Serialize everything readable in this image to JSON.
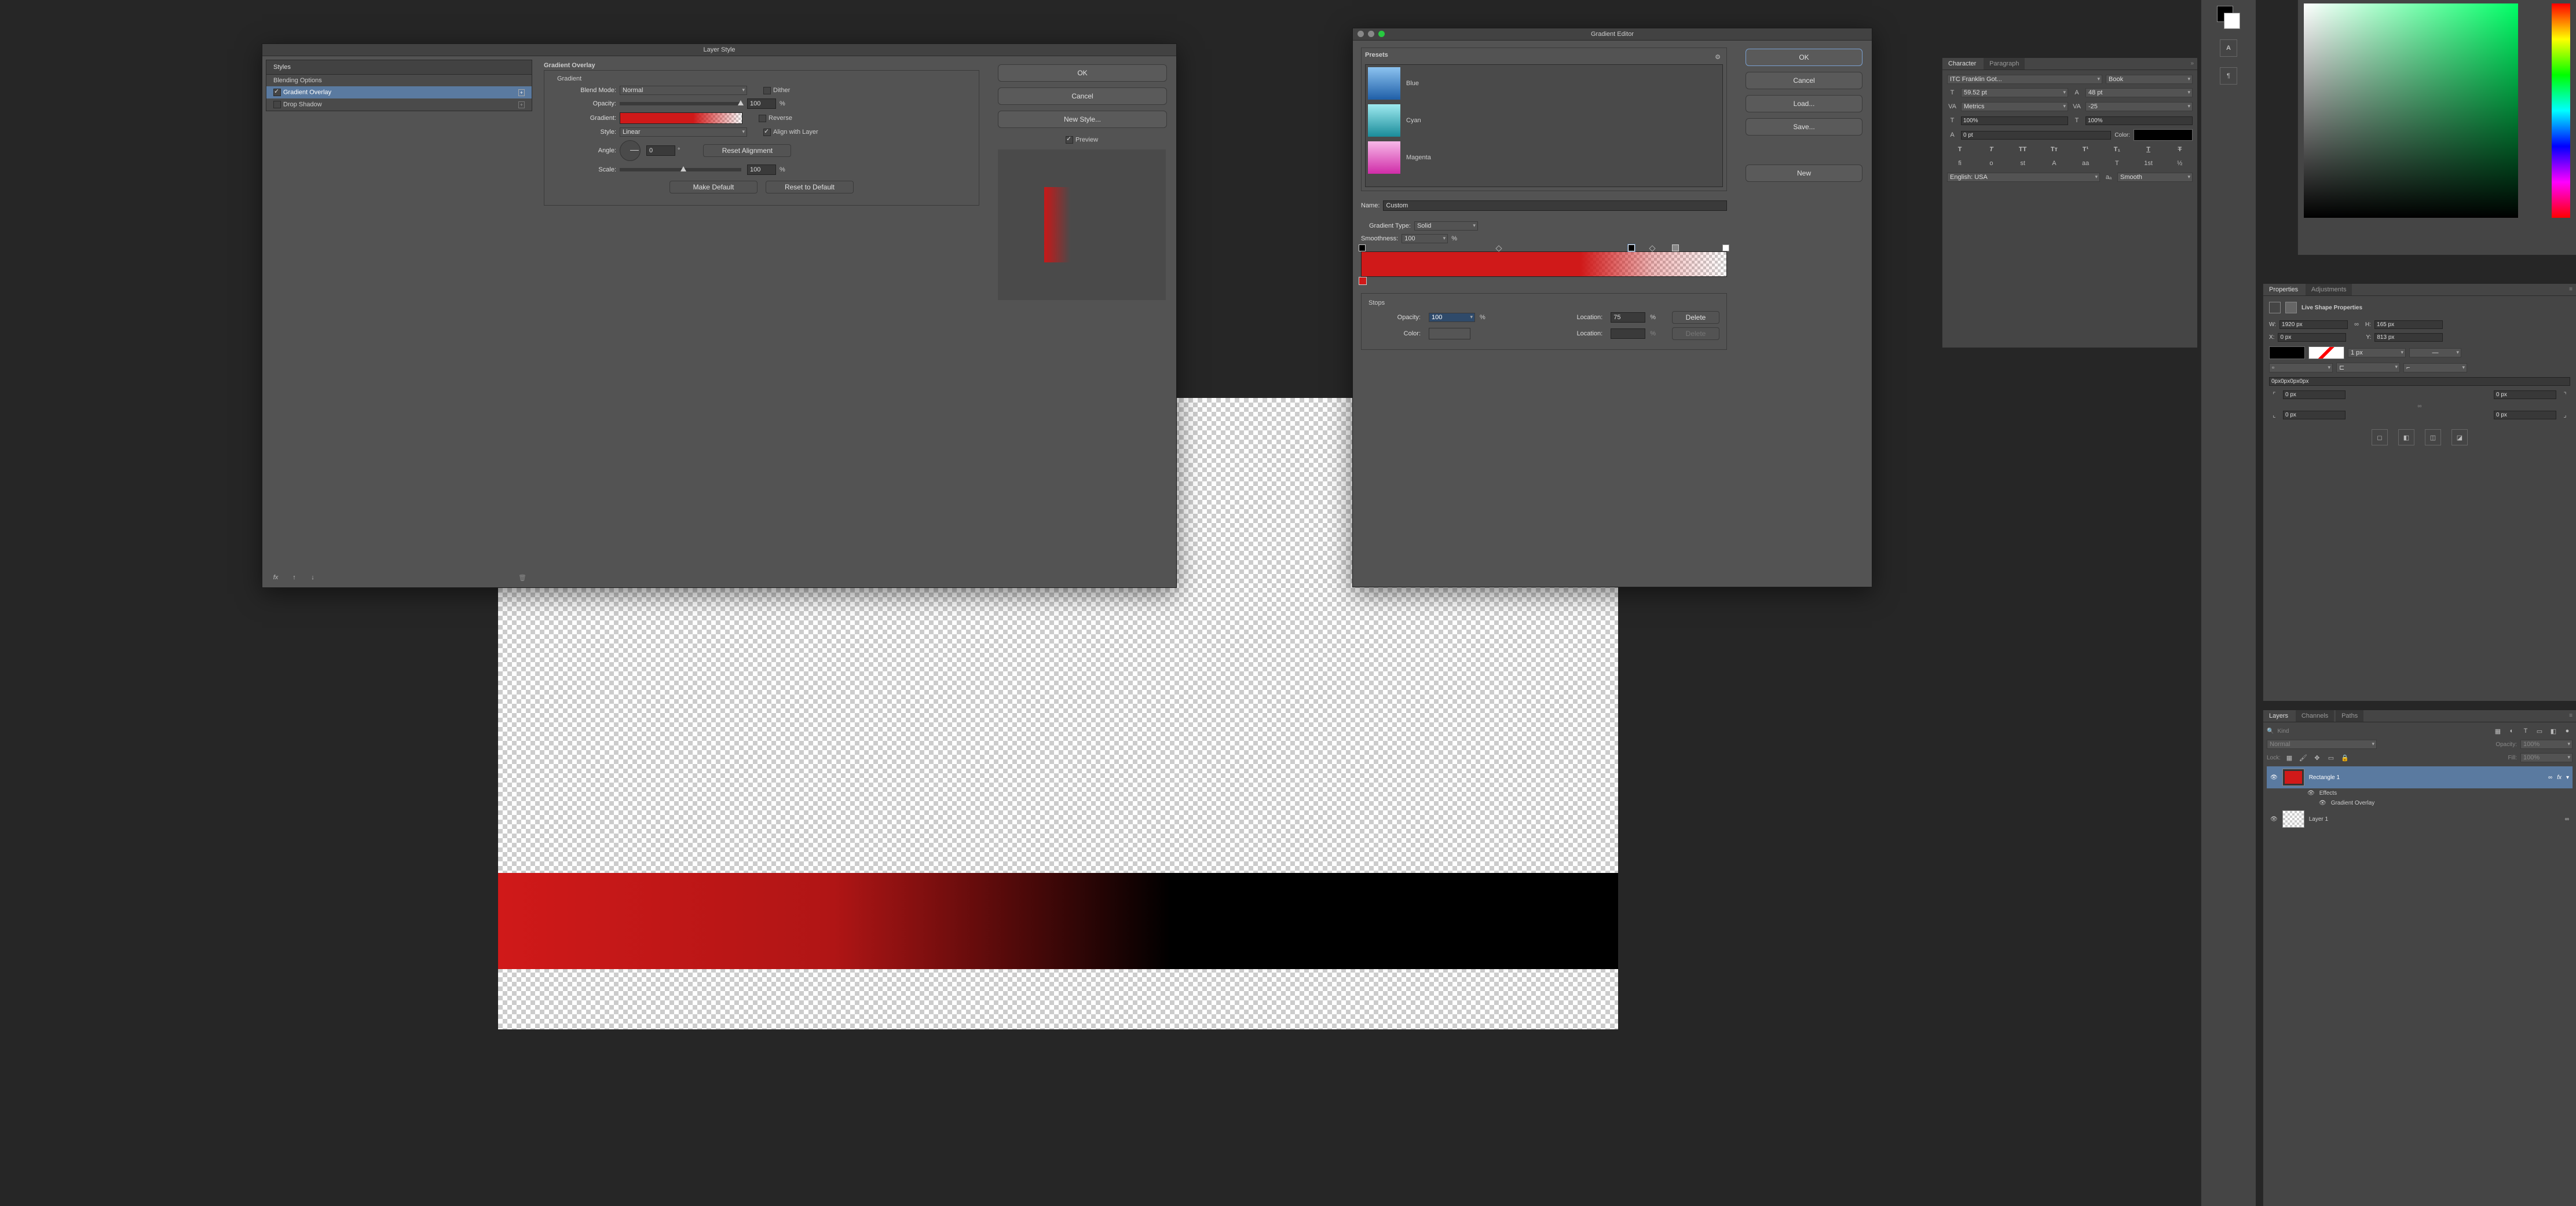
{
  "layer_style": {
    "title": "Layer Style",
    "styles_header": "Styles",
    "styles": [
      "Blending Options",
      "Gradient Overlay",
      "Drop Shadow"
    ],
    "active_style": "Gradient Overlay",
    "section_title": "Gradient Overlay",
    "subsection": "Gradient",
    "blend_mode_label": "Blend Mode:",
    "blend_mode_value": "Normal",
    "dither_label": "Dither",
    "opacity_label": "Opacity:",
    "opacity_value": "100",
    "pct": "%",
    "gradient_label": "Gradient:",
    "reverse_label": "Reverse",
    "style_label": "Style:",
    "style_value": "Linear",
    "align_label": "Align with Layer",
    "angle_label": "Angle:",
    "angle_value": "0",
    "degree": "°",
    "reset_alignment": "Reset Alignment",
    "scale_label": "Scale:",
    "scale_value": "100",
    "make_default": "Make Default",
    "reset_default": "Reset to Default",
    "ok": "OK",
    "cancel": "Cancel",
    "new_style": "New Style...",
    "preview": "Preview"
  },
  "gradient_editor": {
    "title": "Gradient Editor",
    "presets_label": "Presets",
    "presets": [
      "Blue",
      "Cyan",
      "Magenta"
    ],
    "preset_colors": [
      "#4a90e2",
      "#3bd4d4",
      "#e055c3"
    ],
    "name_label": "Name:",
    "name_value": "Custom",
    "type_label": "Gradient Type:",
    "type_value": "Solid",
    "smoothness_label": "Smoothness:",
    "smoothness_value": "100",
    "pct": "%",
    "stops_label": "Stops",
    "opacity_label": "Opacity:",
    "opacity_value": "100",
    "location_label": "Location:",
    "location_value": "75",
    "color_label": "Color:",
    "delete": "Delete",
    "ok": "OK",
    "cancel": "Cancel",
    "load": "Load...",
    "save": "Save...",
    "new": "New"
  },
  "character": {
    "tab1": "Character",
    "tab2": "Paragraph",
    "font": "ITC Franklin Got...",
    "weight": "Book",
    "size": "59.52 pt",
    "leading": "48 pt",
    "kerning": "Metrics",
    "tracking": "-25",
    "vscale": "100%",
    "hscale": "100%",
    "baseline": "0 pt",
    "color_label": "Color:",
    "lang": "English: USA",
    "aa": "Smooth"
  },
  "properties": {
    "tab1": "Properties",
    "tab2": "Adjustments",
    "section": "Live Shape Properties",
    "w_label": "W:",
    "w_value": "1920 px",
    "h_label": "H:",
    "h_value": "165 px",
    "x_label": "X:",
    "x_value": "0 px",
    "y_label": "Y:",
    "y_value": "813 px",
    "stroke": "1 px",
    "corners": "0px0px0px0px",
    "corner_val": "0 px"
  },
  "layers": {
    "tabs": [
      "Layers",
      "Channels",
      "Paths"
    ],
    "kind": "Kind",
    "blend": "Normal",
    "opacity_label": "Opacity:",
    "opacity": "100%",
    "lock_label": "Lock:",
    "fill_label": "Fill:",
    "fill": "100%",
    "items": [
      "Rectangle 1",
      "Effects",
      "Gradient Overlay",
      "Layer 1"
    ]
  }
}
